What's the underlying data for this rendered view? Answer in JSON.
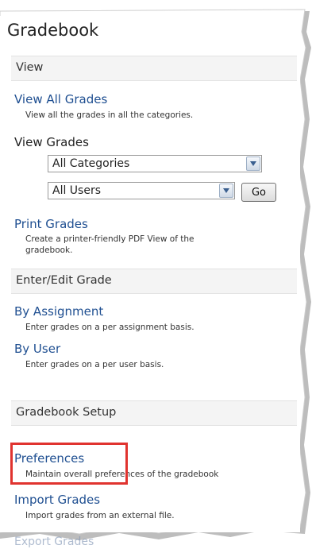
{
  "title": "Gradebook",
  "sections": {
    "view": "View",
    "enter_edit": "Enter/Edit Grade",
    "setup": "Gradebook Setup"
  },
  "view_all": {
    "link": "View All Grades",
    "description": "View all the grades in all the categories."
  },
  "view_grades": {
    "label": "View Grades",
    "category_select": "All Categories",
    "user_select": "All Users",
    "go_button": "Go"
  },
  "print_grades": {
    "link": "Print Grades",
    "description_line1": "Create a printer-friendly PDF View of the",
    "description_line2": "gradebook."
  },
  "by_assignment": {
    "link": "By Assignment",
    "description": "Enter grades on a per assignment basis."
  },
  "by_user": {
    "link": "By User",
    "description": "Enter grades on a per user basis."
  },
  "preferences": {
    "link": "Preferences",
    "description": "Maintain overall preferences of the gradebook"
  },
  "import_grades": {
    "link": "Import Grades",
    "description": "Import grades from an external file."
  },
  "cut_off_link": "Export Grades",
  "colors": {
    "link": "#1f4f91",
    "highlight": "#e0332f",
    "section_bg": "#f4f4f4"
  }
}
